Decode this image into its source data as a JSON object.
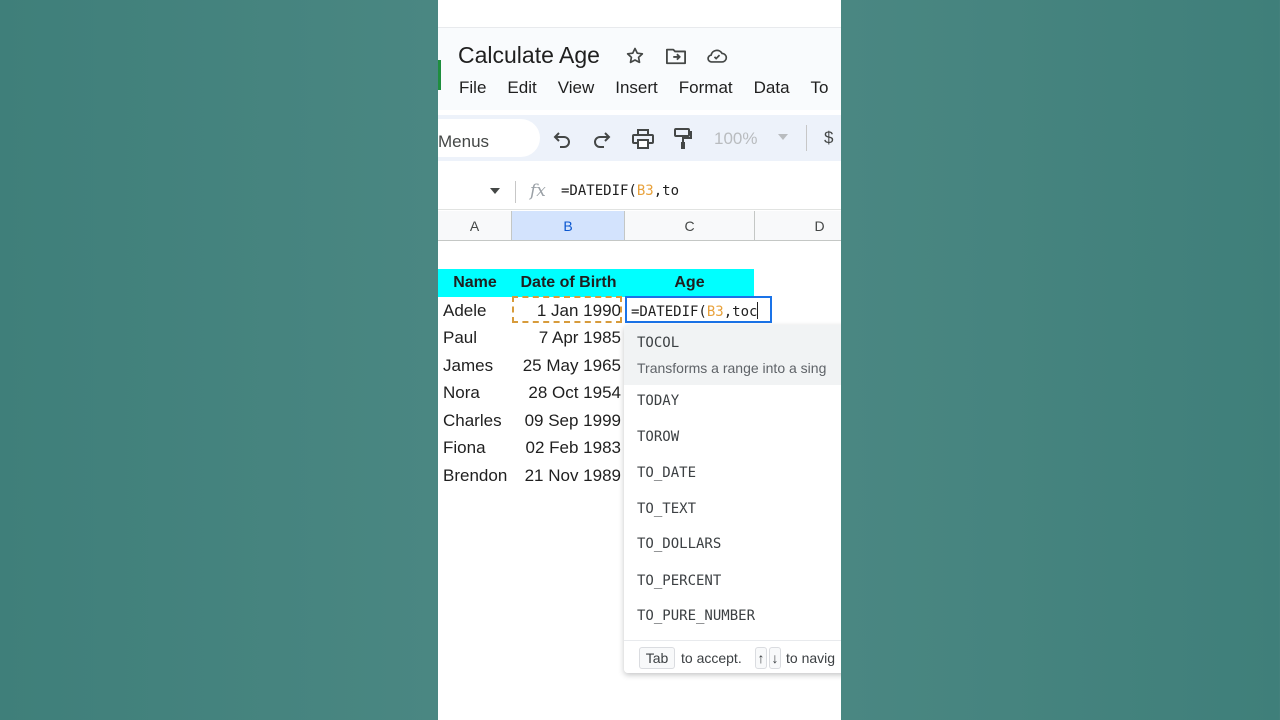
{
  "doc": {
    "title": "Calculate Age"
  },
  "menu": [
    "File",
    "Edit",
    "View",
    "Insert",
    "Format",
    "Data",
    "To"
  ],
  "toolbar": {
    "search_label": "Menus",
    "zoom": "100%",
    "currency": "$"
  },
  "formula_bar": {
    "prefix": "=DATEDIF(",
    "ref": "B3",
    "suffix": ",to"
  },
  "columns": [
    "A",
    "B",
    "C",
    "D"
  ],
  "table": {
    "headers": [
      "Name",
      "Date of Birth",
      "Age"
    ],
    "rows": [
      {
        "name": "Adele",
        "dob": "1 Jan 1990"
      },
      {
        "name": "Paul",
        "dob": "7 Apr 1985"
      },
      {
        "name": "James",
        "dob": "25 May 1965"
      },
      {
        "name": "Nora",
        "dob": "28 Oct 1954"
      },
      {
        "name": "Charles",
        "dob": "09 Sep 1999"
      },
      {
        "name": "Fiona",
        "dob": "02 Feb 1983"
      },
      {
        "name": "Brendon",
        "dob": "21 Nov 1989"
      }
    ]
  },
  "editor": {
    "prefix": "=DATEDIF(",
    "ref": "B3",
    "suffix": ",toc"
  },
  "suggestions": {
    "items": [
      "TOCOL",
      "TODAY",
      "TOROW",
      "TO_DATE",
      "TO_TEXT",
      "TO_DOLLARS",
      "TO_PERCENT",
      "TO_PURE_NUMBER"
    ],
    "first_description": "Transforms a range into a sing",
    "footer": {
      "tab_key": "Tab",
      "accept_text": "to accept.",
      "up_key": "↑",
      "down_key": "↓",
      "navigate_text": "to navig"
    }
  },
  "colors": {
    "header_fill": "#00ffff",
    "selected_column": "#d3e3fd",
    "reference": "#e8a23c",
    "editor_border": "#1a73e8",
    "background": "#43817c"
  }
}
